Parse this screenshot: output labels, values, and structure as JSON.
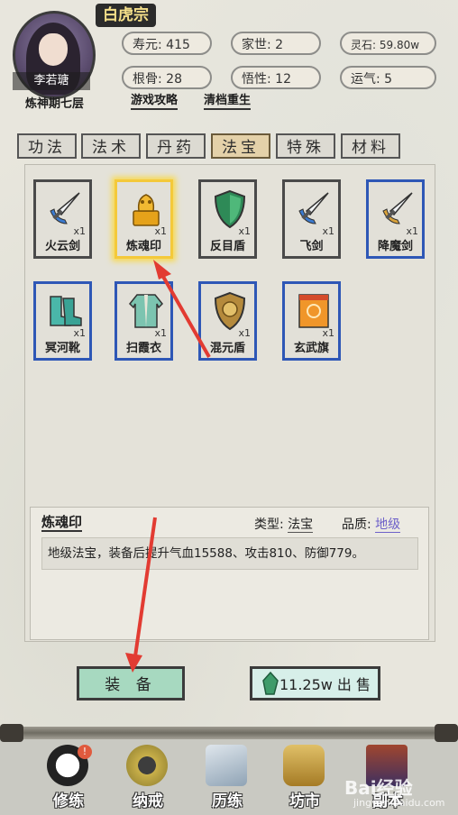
{
  "header": {
    "sect": "白虎宗",
    "character_name": "李若瑭",
    "realm": "炼神期七层",
    "stats": [
      {
        "label": "寿元:",
        "value": "415"
      },
      {
        "label": "家世:",
        "value": "2"
      },
      {
        "label": "灵石:",
        "value": "59.80w"
      },
      {
        "label": "根骨:",
        "value": "28"
      },
      {
        "label": "悟性:",
        "value": "12"
      },
      {
        "label": "运气:",
        "value": "5"
      }
    ],
    "links": [
      "游戏攻略",
      "清档重生"
    ]
  },
  "tabs": [
    {
      "label": "功法",
      "active": false
    },
    {
      "label": "法术",
      "active": false
    },
    {
      "label": "丹药",
      "active": false
    },
    {
      "label": "法宝",
      "active": true
    },
    {
      "label": "特殊",
      "active": false
    },
    {
      "label": "材料",
      "active": false
    }
  ],
  "items": [
    {
      "name": "火云剑",
      "qty": "x1",
      "icon": "sword-icon",
      "border": "dark"
    },
    {
      "name": "炼魂印",
      "qty": "x1",
      "icon": "seal-icon",
      "border": "gold",
      "selected": true
    },
    {
      "name": "反目盾",
      "qty": "x1",
      "icon": "shield-icon",
      "border": "dark"
    },
    {
      "name": "飞剑",
      "qty": "x1",
      "icon": "sword-icon",
      "border": "dark"
    },
    {
      "name": "降魔剑",
      "qty": "x1",
      "icon": "sword-icon",
      "border": "blue"
    },
    {
      "name": "冥河靴",
      "qty": "x1",
      "icon": "boots-icon",
      "border": "blue"
    },
    {
      "name": "扫霞衣",
      "qty": "x1",
      "icon": "robe-icon",
      "border": "blue"
    },
    {
      "name": "混元盾",
      "qty": "x1",
      "icon": "shield-icon",
      "border": "blue"
    },
    {
      "name": "玄武旗",
      "qty": "x1",
      "icon": "flag-icon",
      "border": "blue"
    }
  ],
  "detail": {
    "title": "炼魂印",
    "type_label": "类型:",
    "type_value": "法宝",
    "quality_label": "品质:",
    "quality_value": "地级",
    "description": "地级法宝，装备后提升气血15588、攻击810、防御779。"
  },
  "buttons": {
    "equip": "装 备",
    "sell": "11.25w 出 售"
  },
  "nav": [
    {
      "label": "修练",
      "icon": "yin-yang-icon",
      "badge": "!"
    },
    {
      "label": "纳戒",
      "icon": "ring-icon"
    },
    {
      "label": "历练",
      "icon": "mountain-icon"
    },
    {
      "label": "坊市",
      "icon": "cauldron-icon"
    },
    {
      "label": "副本",
      "icon": "pagoda-icon"
    }
  ],
  "watermark": {
    "main": "Bai经验",
    "sub": "jingyan.baidu.com"
  },
  "colors": {
    "selected_border": "#f4c93a",
    "rare_border": "#2e57b6",
    "equip_button": "#a7d9c0",
    "quality_text": "#6e61c9",
    "arrow": "#e23b32"
  }
}
